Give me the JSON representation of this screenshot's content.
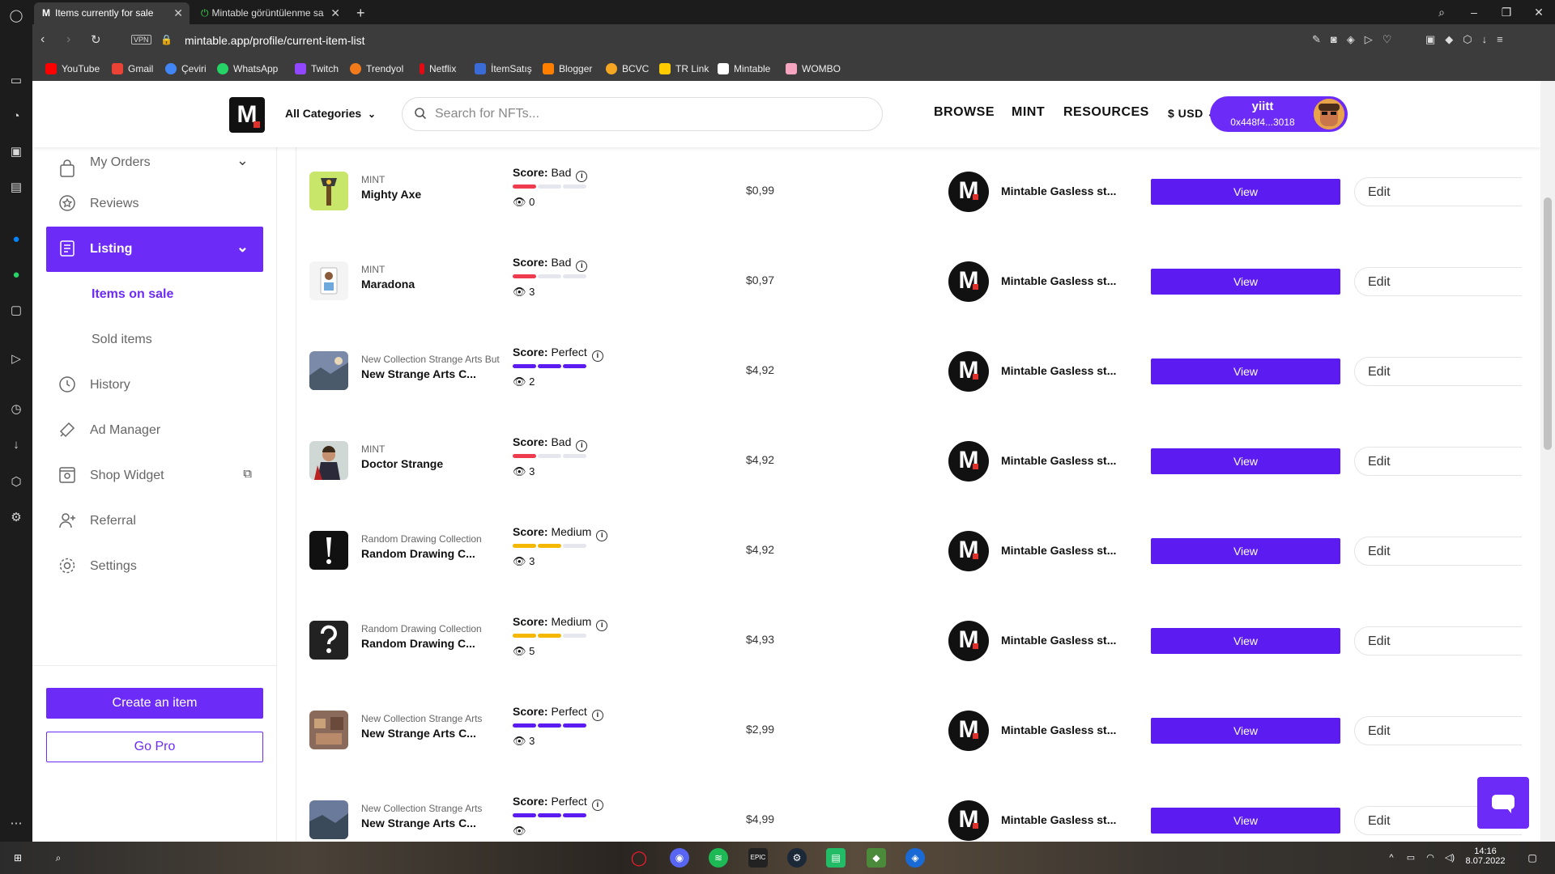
{
  "browser": {
    "tabs": [
      {
        "title": "Items currently for sale",
        "active": true
      },
      {
        "title": "Mintable görüntülenme sa",
        "active": false
      }
    ],
    "new_tab": "+",
    "vpn_label": "VPN",
    "url": "mintable.app/profile/current-item-list",
    "bookmarks": [
      {
        "label": "YouTube",
        "color": "#ff0000"
      },
      {
        "label": "Gmail",
        "color": "#ea4335"
      },
      {
        "label": "Çeviri",
        "color": "#4285f4"
      },
      {
        "label": "WhatsApp",
        "color": "#25d366"
      },
      {
        "label": "Twitch",
        "color": "#9146ff"
      },
      {
        "label": "Trendyol",
        "color": "#f27a1a"
      },
      {
        "label": "Netflix",
        "color": "#e50914"
      },
      {
        "label": "İtemSatış",
        "color": "#3b6bd6"
      },
      {
        "label": "Blogger",
        "color": "#ff8000"
      },
      {
        "label": "BCVC",
        "color": "#f5a623"
      },
      {
        "label": "TR Link",
        "color": "#ffcc00"
      },
      {
        "label": "Mintable",
        "color": "#ffffff"
      },
      {
        "label": "WOMBO",
        "color": "#f6a5c0"
      }
    ]
  },
  "header": {
    "logo": "M",
    "categories_label": "All Categories",
    "search_placeholder": "Search for NFTs...",
    "nav": [
      "BROWSE",
      "MINT",
      "RESOURCES"
    ],
    "currency": "$ USD",
    "user_name": "yiitt",
    "user_address": "0x448f4...3018"
  },
  "sidebar": {
    "items": [
      {
        "label": "My Orders"
      },
      {
        "label": "Reviews"
      },
      {
        "label": "Listing"
      },
      {
        "label": "History"
      },
      {
        "label": "Ad Manager"
      },
      {
        "label": "Shop Widget"
      },
      {
        "label": "Referral"
      },
      {
        "label": "Settings"
      }
    ],
    "submenu": [
      "Items on sale",
      "Sold items"
    ],
    "create_label": "Create an item",
    "gopro_label": "Go Pro"
  },
  "score_prefix": "Score:",
  "view_label": "View",
  "edit_label": "Edit",
  "listings": [
    {
      "collection": "MINT",
      "name": "Mighty Axe",
      "score": "Bad",
      "score_level": 1,
      "views": "0",
      "price": "$0,99",
      "store": "Mintable Gasless st..."
    },
    {
      "collection": "MINT",
      "name": "Maradona",
      "score": "Bad",
      "score_level": 1,
      "views": "3",
      "price": "$0,97",
      "store": "Mintable Gasless st..."
    },
    {
      "collection": "New Collection Strange Arts But",
      "name": "New Strange Arts C...",
      "score": "Perfect",
      "score_level": 3,
      "views": "2",
      "price": "$4,92",
      "store": "Mintable Gasless st..."
    },
    {
      "collection": "MINT",
      "name": "Doctor Strange",
      "score": "Bad",
      "score_level": 1,
      "views": "3",
      "price": "$4,92",
      "store": "Mintable Gasless st..."
    },
    {
      "collection": "Random Drawing Collection",
      "name": "Random Drawing C...",
      "score": "Medium",
      "score_level": 2,
      "views": "3",
      "price": "$4,92",
      "store": "Mintable Gasless st..."
    },
    {
      "collection": "Random Drawing Collection",
      "name": "Random Drawing C...",
      "score": "Medium",
      "score_level": 2,
      "views": "5",
      "price": "$4,93",
      "store": "Mintable Gasless st..."
    },
    {
      "collection": "New Collection Strange Arts",
      "name": "New Strange Arts C...",
      "score": "Perfect",
      "score_level": 3,
      "views": "3",
      "price": "$2,99",
      "store": "Mintable Gasless st..."
    },
    {
      "collection": "New Collection Strange Arts",
      "name": "New Strange Arts C...",
      "score": "Perfect",
      "score_level": 3,
      "views": "",
      "price": "$4,99",
      "store": "Mintable Gasless st..."
    }
  ],
  "score_colors": {
    "Bad": "#ef3b4e",
    "Medium": "#f5b800",
    "Perfect": "#5c1bf0"
  },
  "taskbar": {
    "time": "14:16",
    "date": "8.07.2022"
  }
}
